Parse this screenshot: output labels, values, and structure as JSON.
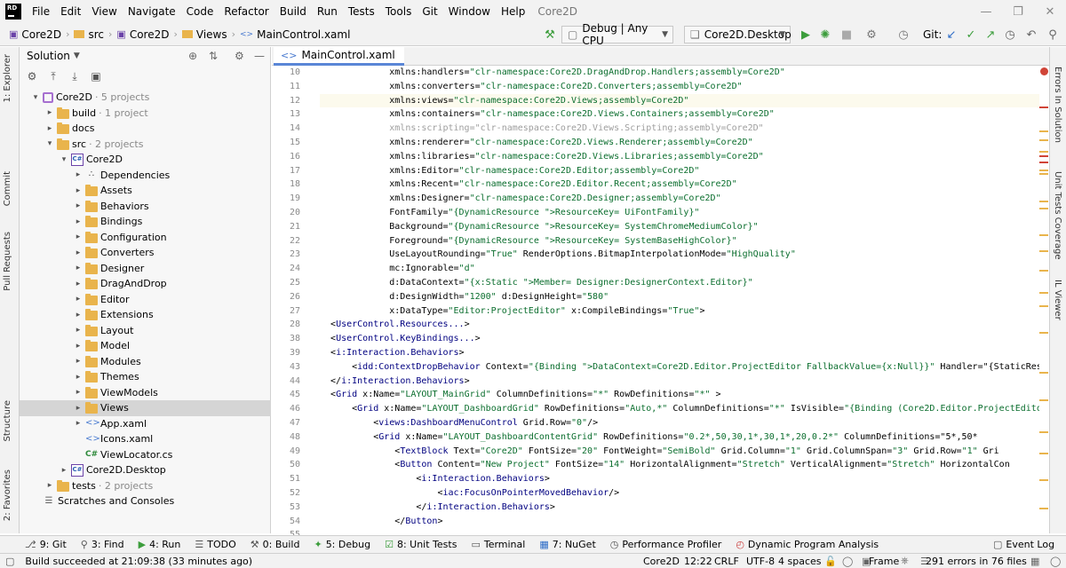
{
  "menu": [
    "File",
    "Edit",
    "View",
    "Navigate",
    "Code",
    "Refactor",
    "Build",
    "Run",
    "Tests",
    "Tools",
    "Git",
    "Window",
    "Help"
  ],
  "app_logo": "RD",
  "project_title": "Core2D",
  "breadcrumb": [
    "Core2D",
    "src",
    "Core2D",
    "Views",
    "MainControl.xaml"
  ],
  "toolbar": {
    "config": "Debug | Any CPU",
    "run_config": "Core2D.Desktop",
    "git_label": "Git:"
  },
  "left_strip": [
    "1: Explorer",
    "Commit",
    "Pull Requests",
    "Structure",
    "2: Favorites"
  ],
  "right_strip": [
    "Errors In Solution",
    "Unit Tests Coverage",
    "IL Viewer"
  ],
  "sidebar": {
    "title": "Solution",
    "tree": [
      {
        "indent": 0,
        "arrow": "▾",
        "icon": "sln",
        "label": "Core2D",
        "muted": "· 5 projects"
      },
      {
        "indent": 1,
        "arrow": "▸",
        "icon": "folder",
        "label": "build",
        "muted": "· 1 project"
      },
      {
        "indent": 1,
        "arrow": "▸",
        "icon": "folder",
        "label": "docs",
        "muted": ""
      },
      {
        "indent": 1,
        "arrow": "▾",
        "icon": "folder",
        "label": "src",
        "muted": "· 2 projects"
      },
      {
        "indent": 2,
        "arrow": "▾",
        "icon": "proj",
        "label": "Core2D",
        "muted": ""
      },
      {
        "indent": 3,
        "arrow": "▸",
        "icon": "dep",
        "label": "Dependencies",
        "muted": ""
      },
      {
        "indent": 3,
        "arrow": "▸",
        "icon": "folder",
        "label": "Assets",
        "muted": ""
      },
      {
        "indent": 3,
        "arrow": "▸",
        "icon": "folder",
        "label": "Behaviors",
        "muted": ""
      },
      {
        "indent": 3,
        "arrow": "▸",
        "icon": "folder",
        "label": "Bindings",
        "muted": ""
      },
      {
        "indent": 3,
        "arrow": "▸",
        "icon": "folder",
        "label": "Configuration",
        "muted": ""
      },
      {
        "indent": 3,
        "arrow": "▸",
        "icon": "folder",
        "label": "Converters",
        "muted": ""
      },
      {
        "indent": 3,
        "arrow": "▸",
        "icon": "folder",
        "label": "Designer",
        "muted": ""
      },
      {
        "indent": 3,
        "arrow": "▸",
        "icon": "folder",
        "label": "DragAndDrop",
        "muted": ""
      },
      {
        "indent": 3,
        "arrow": "▸",
        "icon": "folder",
        "label": "Editor",
        "muted": ""
      },
      {
        "indent": 3,
        "arrow": "▸",
        "icon": "folder",
        "label": "Extensions",
        "muted": ""
      },
      {
        "indent": 3,
        "arrow": "▸",
        "icon": "folder",
        "label": "Layout",
        "muted": ""
      },
      {
        "indent": 3,
        "arrow": "▸",
        "icon": "folder",
        "label": "Model",
        "muted": ""
      },
      {
        "indent": 3,
        "arrow": "▸",
        "icon": "folder",
        "label": "Modules",
        "muted": ""
      },
      {
        "indent": 3,
        "arrow": "▸",
        "icon": "folder",
        "label": "Themes",
        "muted": ""
      },
      {
        "indent": 3,
        "arrow": "▸",
        "icon": "folder",
        "label": "ViewModels",
        "muted": ""
      },
      {
        "indent": 3,
        "arrow": "▸",
        "icon": "folder",
        "label": "Views",
        "muted": "",
        "selected": true
      },
      {
        "indent": 3,
        "arrow": "▸",
        "icon": "xaml",
        "label": "App.xaml",
        "muted": ""
      },
      {
        "indent": 3,
        "arrow": "",
        "icon": "xaml",
        "label": "Icons.xaml",
        "muted": ""
      },
      {
        "indent": 3,
        "arrow": "",
        "icon": "cs",
        "label": "ViewLocator.cs",
        "muted": ""
      },
      {
        "indent": 2,
        "arrow": "▸",
        "icon": "proj",
        "label": "Core2D.Desktop",
        "muted": ""
      },
      {
        "indent": 1,
        "arrow": "▸",
        "icon": "folder",
        "label": "tests",
        "muted": "· 2 projects"
      },
      {
        "indent": 0,
        "arrow": "",
        "icon": "scratch",
        "label": "Scratches and Consoles",
        "muted": ""
      }
    ]
  },
  "editor": {
    "tab": "MainControl.xaml",
    "line_numbers": [
      10,
      11,
      12,
      13,
      14,
      15,
      16,
      17,
      18,
      19,
      20,
      21,
      22,
      23,
      24,
      25,
      26,
      27,
      28,
      38,
      39,
      43,
      44,
      45,
      46,
      47,
      48,
      49,
      50,
      51,
      52,
      53,
      54,
      55
    ],
    "lines": [
      "             xmlns:handlers=\"clr-namespace:Core2D.DragAndDrop.Handlers;assembly=Core2D\"",
      "             xmlns:converters=\"clr-namespace:Core2D.Converters;assembly=Core2D\"",
      "             xmlns:views=\"clr-namespace:Core2D.Views;assembly=Core2D\"",
      "             xmlns:containers=\"clr-namespace:Core2D.Views.Containers;assembly=Core2D\"",
      "             xmlns:scripting=\"clr-namespace:Core2D.Views.Scripting;assembly=Core2D\"",
      "             xmlns:renderer=\"clr-namespace:Core2D.Views.Renderer;assembly=Core2D\"",
      "             xmlns:libraries=\"clr-namespace:Core2D.Views.Libraries;assembly=Core2D\"",
      "             xmlns:Editor=\"clr-namespace:Core2D.Editor;assembly=Core2D\"",
      "             xmlns:Recent=\"clr-namespace:Core2D.Editor.Recent;assembly=Core2D\"",
      "             xmlns:Designer=\"clr-namespace:Core2D.Designer;assembly=Core2D\"",
      "             FontFamily=\"{DynamicResource [ResourceKey=] UiFontFamily}\"",
      "             Background=\"{DynamicResource [ResourceKey=] SystemChromeMediumColor}\"",
      "             Foreground=\"{DynamicResource [ResourceKey=] SystemBaseHighColor}\"",
      "             UseLayoutRounding=\"True\" RenderOptions.BitmapInterpolationMode=\"HighQuality\"",
      "             mc:Ignorable=\"d\"",
      "             d:DataContext=\"{x:Static [Member=] Designer:DesignerContext.Editor}\"",
      "             d:DesignWidth=\"1200\" d:DesignHeight=\"580\"",
      "             x:DataType=\"Editor:ProjectEditor\" x:CompileBindings=\"True\">",
      "  <UserControl.Resources...>",
      "  <UserControl.KeyBindings...>",
      "  <i:Interaction.Behaviors>",
      "      <idd:ContextDropBehavior Context=\"{Binding [DataContext=Core2D.Editor.ProjectEditor] FallbackValue={x:Null}}\" Handler=\"{StaticResou",
      "  </i:Interaction.Behaviors>",
      "  <Grid x:Name=\"LAYOUT_MainGrid\" ColumnDefinitions=\"*\" RowDefinitions=\"*\" >",
      "      <Grid x:Name=\"LAYOUT_DashboardGrid\" RowDefinitions=\"Auto,*\" ColumnDefinitions=\"*\" IsVisible=\"{Binding [(Core2D.Editor.ProjectEdito]",
      "          <views:DashboardMenuControl Grid.Row=\"0\"/>",
      "          <Grid x:Name=\"LAYOUT_DashboardContentGrid\" RowDefinitions=\"0.2*,50,30,1*,30,1*,20,0.2*\" ColumnDefinitions=\"5*,50*",
      "              <TextBlock Text=\"Core2D\" FontSize=\"20\" FontWeight=\"SemiBold\" Grid.Column=\"1\" Grid.ColumnSpan=\"3\" Grid.Row=\"1\" Gri",
      "              <Button Content=\"New Project\" FontSize=\"14\" HorizontalAlignment=\"Stretch\" VerticalAlignment=\"Stretch\" HorizontalCon",
      "                  <i:Interaction.Behaviors>",
      "                      <iac:FocusOnPointerMovedBehavior/>",
      "                  </i:Interaction.Behaviors>",
      "              </Button>",
      ""
    ]
  },
  "bottom_tools": [
    {
      "icon": "git",
      "label": "9: Git"
    },
    {
      "icon": "find",
      "label": "3: Find"
    },
    {
      "icon": "run",
      "label": "4: Run"
    },
    {
      "icon": "todo",
      "label": "TODO"
    },
    {
      "icon": "build",
      "label": "0: Build"
    },
    {
      "icon": "debug",
      "label": "5: Debug"
    },
    {
      "icon": "tests",
      "label": "8: Unit Tests"
    },
    {
      "icon": "terminal",
      "label": "Terminal"
    },
    {
      "icon": "nuget",
      "label": "7: NuGet"
    },
    {
      "icon": "profiler",
      "label": "Performance Profiler"
    },
    {
      "icon": "dpa",
      "label": "Dynamic Program Analysis"
    }
  ],
  "event_log": "Event Log",
  "status": {
    "message": "Build succeeded at 21:09:38 (33 minutes ago)",
    "project": "Core2D",
    "position": "12:22",
    "line_ending": "CRLF",
    "encoding": "UTF-8",
    "indent": "4 spaces",
    "frame": "Frame",
    "errors": "291 errors in 76 files"
  }
}
